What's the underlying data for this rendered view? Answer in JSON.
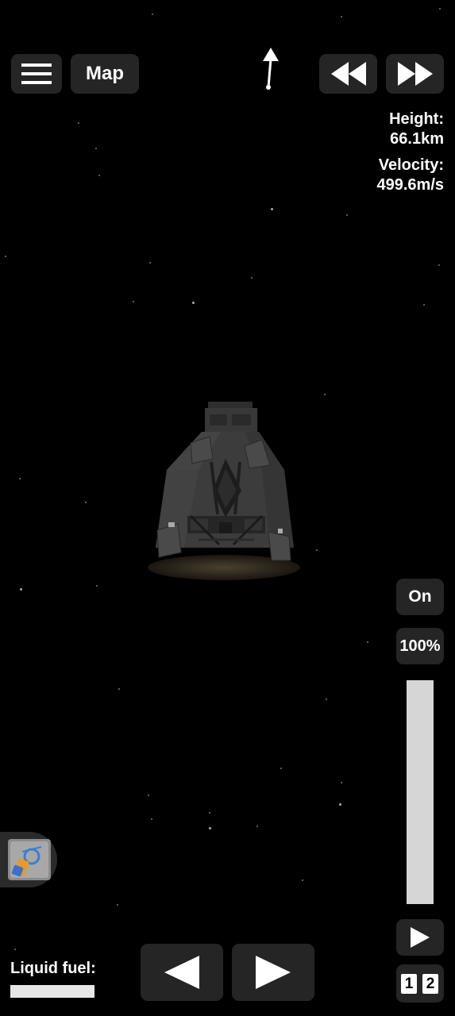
{
  "top_bar": {
    "menu_icon": "hamburger-menu-icon",
    "map_label": "Map",
    "heading_icon": "direction-arrow-icon",
    "rewind_icon": "rewind-icon",
    "fast_forward_icon": "fast-forward-icon"
  },
  "telemetry": {
    "height_label": "Height:",
    "height_value": "66.1km",
    "velocity_label": "Velocity:",
    "velocity_value": "499.6m/s"
  },
  "engine": {
    "toggle_label": "On",
    "throttle_label": "100%",
    "throttle_fraction": 1.0,
    "play_icon": "play-icon"
  },
  "stages": [
    "1",
    "2"
  ],
  "fuel": {
    "label": "Liquid fuel:",
    "fraction": 1.0
  },
  "controls": {
    "rotate_left_icon": "rotate-left-arrow-icon",
    "rotate_right_icon": "rotate-right-arrow-icon",
    "part_icon": "part-toggle-icon"
  },
  "colors": {
    "background": "#000000",
    "button": "#252525",
    "throttle_fill": "#d6d6d6",
    "capsule": "#3d3d3d",
    "heat_shield": "#2a241c"
  }
}
